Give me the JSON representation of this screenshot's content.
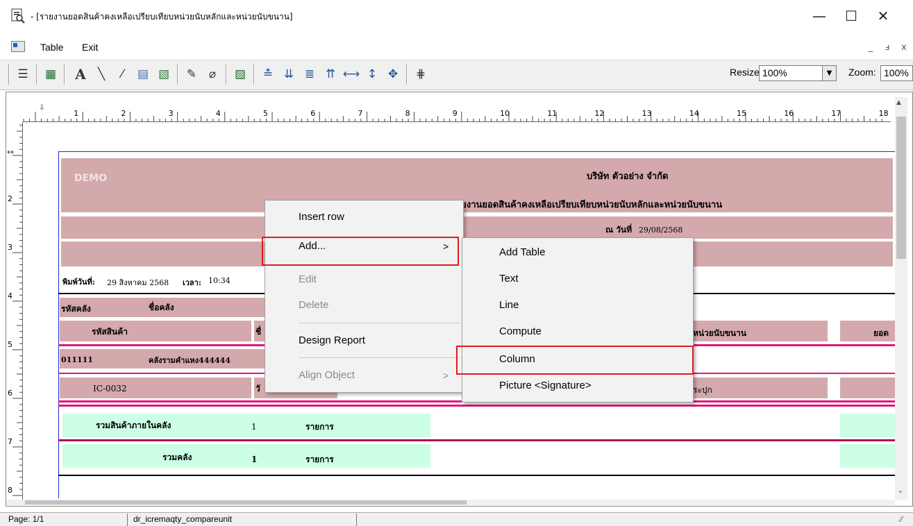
{
  "window": {
    "title": "- [รายงานยอดสินค้าคงเหลือเปรียบเทียบหน่วยนับหลักและหน่วยนับขนาน]",
    "minimize_glyph": "—",
    "maximize_glyph": "☐",
    "close_glyph": "✕"
  },
  "menubar": {
    "items": [
      "Table",
      "Exit"
    ],
    "mdi": {
      "min": "_",
      "restore": "ⅎ",
      "close": "x"
    }
  },
  "toolbar": {
    "icons": [
      "columns-icon",
      "grid-icon",
      "text-icon",
      "line-icon",
      "compute-icon",
      "column-insert-icon",
      "picture-icon",
      "report-icon",
      "eraser-icon",
      "design-icon",
      "align-bottom-icon",
      "align-top-icon",
      "align-left-icon",
      "align-right-icon",
      "width-icon",
      "height-icon",
      "size-icon",
      "tab-order-icon"
    ],
    "glyphs": [
      "☰",
      "▦",
      "A",
      "╲",
      "⁄",
      "▤",
      "▧",
      "✎",
      "⌀",
      "▨",
      "≛",
      "⇊",
      "≣",
      "⇈",
      "⟷",
      "↕",
      "✥",
      "⋕"
    ],
    "resize_label": "Resize:",
    "resize_value": "100%",
    "zoom_label": "Zoom:",
    "zoom_value": "100%"
  },
  "ruler": {
    "h_numbers": [
      "1",
      "2",
      "3",
      "4",
      "5",
      "6",
      "7",
      "8",
      "9",
      "10",
      "11",
      "12",
      "13",
      "14",
      "15",
      "16",
      "17",
      "18"
    ],
    "v_numbers": [
      "2",
      "3",
      "4",
      "5",
      "6",
      "7",
      "8"
    ]
  },
  "report": {
    "demo": "DEMO",
    "company": "บริษัท ตัวอย่าง จำกัด",
    "report_title": "รายงานยอดสินค้าคงเหลือเปรียบเทียบหน่วยนับหลักและหน่วยนับขนาน",
    "as_of": "ณ วันที่",
    "as_of_date": "29/08/2568",
    "print_date_label": "พิมพ์วันที่:",
    "print_date": "29 สิงหาคม 2568",
    "time_label": "เวลา:",
    "time": "10:34",
    "col_wh_code": "รหัสคลัง",
    "col_wh_name": "ชื่อคลัง",
    "col_item_code": "รหัสสินค้า",
    "col_item_name_partial": "ชื่",
    "col_parallel_unit": "หน่วยนับขนาน",
    "col_balance_partial": "ยอด",
    "wh_code_value": "011111",
    "wh_name_value": "คลังรามคำแหง444444",
    "item_code_value": "IC-0032",
    "item_name_partial": "วั",
    "unit_value_partial": "ระปุก",
    "sum_in_wh": "รวมสินค้าภายในคลัง",
    "sum_in_wh_count": "1",
    "items_word": "รายการ",
    "sum_wh": "รวมคลัง",
    "sum_wh_count": "1",
    "items_word2": "รายการ"
  },
  "context_menu": {
    "items": [
      {
        "label": "Insert row",
        "enabled": true
      },
      {
        "label": "Add...",
        "enabled": true,
        "submenu": true,
        "arrow": ">"
      },
      {
        "label": "Edit",
        "enabled": false
      },
      {
        "label": "Delete",
        "enabled": false
      },
      {
        "label": "Design Report",
        "enabled": true
      },
      {
        "label": "Align Object",
        "enabled": false,
        "submenu": true,
        "arrow": ">"
      }
    ]
  },
  "submenu": {
    "items": [
      "Add Table",
      "Text",
      "Line",
      "Compute",
      "Column",
      "Picture <Signature>"
    ]
  },
  "highlight_color": "#e5181c",
  "band_color": "#d4a9ac",
  "summary_color": "#ccffe5",
  "accent_pink": "#e0167a",
  "statusbar": {
    "page": "Page: 1/1",
    "datawindow": "dr_icremaqty_compareunit"
  }
}
